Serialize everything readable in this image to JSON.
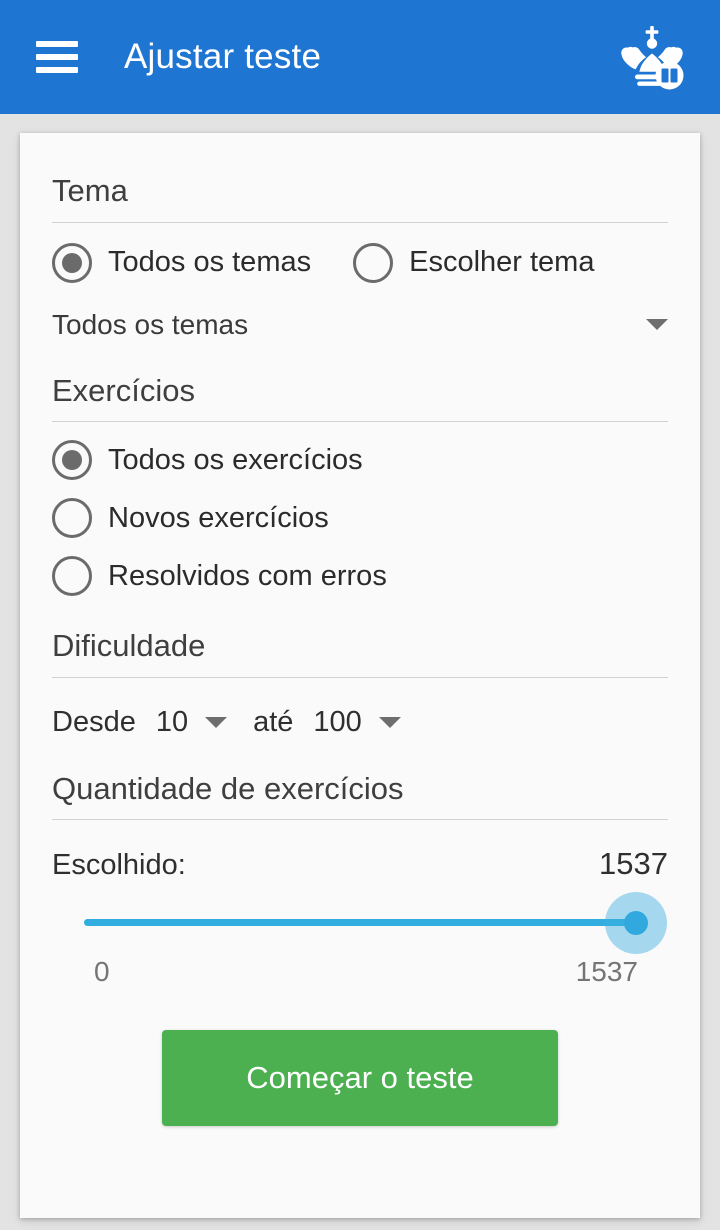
{
  "appbar": {
    "menu_icon": "hamburger-menu-icon",
    "title": "Ajustar teste",
    "logo_icon": "chess-king-book-logo",
    "background_color": "#1f76d2"
  },
  "sections": {
    "theme": {
      "heading": "Tema",
      "options": [
        {
          "label": "Todos os temas",
          "selected": true
        },
        {
          "label": "Escolher tema",
          "selected": false
        }
      ],
      "select": {
        "value": "Todos os temas",
        "caret_icon": "caret-down-icon"
      }
    },
    "exercises": {
      "heading": "Exercícios",
      "options": [
        {
          "label": "Todos os exercícios",
          "selected": true
        },
        {
          "label": "Novos exercícios",
          "selected": false
        },
        {
          "label": "Resolvidos com erros",
          "selected": false
        }
      ]
    },
    "difficulty": {
      "heading": "Dificuldade",
      "from_label": "Desde",
      "from_value": "10",
      "to_label": "até",
      "to_value": "100",
      "caret_icon": "caret-down-icon"
    },
    "quantity": {
      "heading": "Quantidade de exercícios",
      "chosen_label": "Escolhido:",
      "chosen_value": "1537",
      "slider": {
        "min_label": "0",
        "max_label": "1537",
        "min": 0,
        "max": 1537,
        "value": 1537,
        "percent": 100,
        "track_color": "#31ade0"
      }
    }
  },
  "actions": {
    "start_button": "Começar o teste",
    "start_button_color": "#4caf50"
  }
}
